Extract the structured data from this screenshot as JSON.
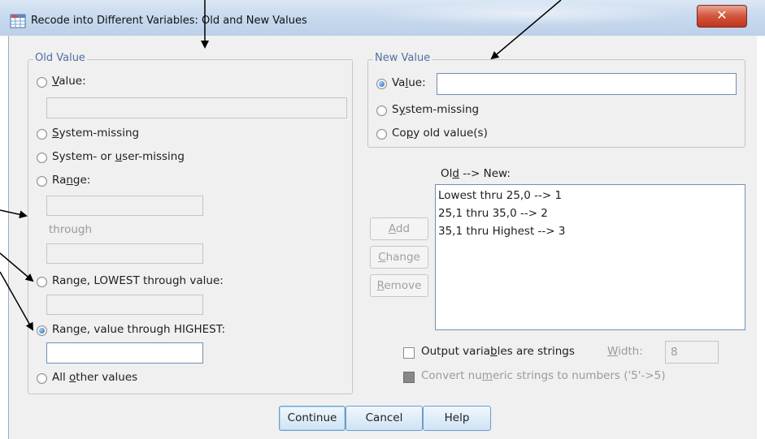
{
  "window": {
    "title": "Recode into Different Variables: Old and New Values",
    "close_glyph": "✕"
  },
  "old_value": {
    "legend": "Old Value",
    "value_label": "Value:",
    "value_input": "",
    "system_missing": "System-missing",
    "system_or_user_missing": "System- or user-missing",
    "range_label": "Range:",
    "range_from": "",
    "through_label": "through",
    "range_to": "",
    "range_lowest_label": "Range, LOWEST through value:",
    "range_lowest_input": "",
    "range_highest_label": "Range, value through HIGHEST:",
    "range_highest_input": "",
    "all_other": "All other values",
    "selected": "range_highest"
  },
  "new_value": {
    "legend": "New Value",
    "value_label": "Value:",
    "value_input": "",
    "system_missing": "System-missing",
    "copy_old": "Copy old value(s)",
    "selected": "value"
  },
  "mapping": {
    "header": "Old --> New:",
    "items": [
      "Lowest thru 25,0 --> 1",
      "25,1 thru 35,0 --> 2",
      "35,1 thru Highest --> 3"
    ]
  },
  "actions": {
    "add": "Add",
    "change": "Change",
    "remove": "Remove"
  },
  "options": {
    "output_strings_label": "Output variables are strings",
    "width_label": "Width:",
    "width_value": "8",
    "convert_label": "Convert numeric strings to numbers ('5'->5)"
  },
  "buttons": {
    "continue": "Continue",
    "cancel": "Cancel",
    "help": "Help"
  },
  "colors": {
    "accent": "#1c63b7",
    "legend": "#4c6fa0",
    "close": "#c1351e"
  }
}
